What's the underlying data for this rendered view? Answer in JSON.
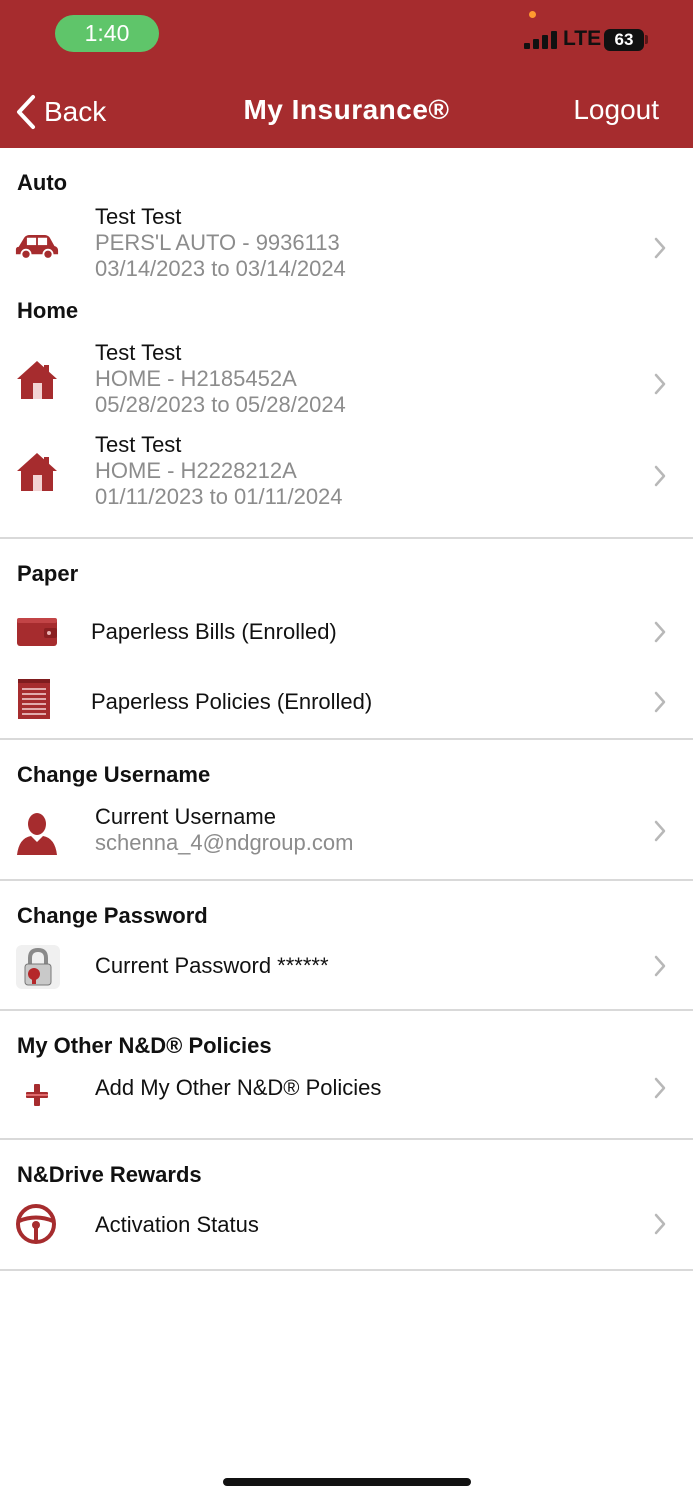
{
  "status_bar": {
    "time": "1:40",
    "network": "LTE",
    "battery": "63"
  },
  "nav": {
    "back_label": "Back",
    "title": "My Insurance®",
    "logout_label": "Logout"
  },
  "sections": {
    "auto": {
      "title": "Auto",
      "items": [
        {
          "name": "Test Test",
          "policy": "PERS'L AUTO - 9936113",
          "dates": "03/14/2023 to 03/14/2024"
        }
      ]
    },
    "home": {
      "title": "Home",
      "items": [
        {
          "name": "Test Test",
          "policy": "HOME - H2185452A",
          "dates": "05/28/2023 to 05/28/2024"
        },
        {
          "name": "Test Test",
          "policy": "HOME - H2228212A",
          "dates": "01/11/2023 to 01/11/2024"
        }
      ]
    },
    "paper": {
      "title": "Paper",
      "bills_label": "Paperless Bills (Enrolled)",
      "policies_label": "Paperless Policies (Enrolled)"
    },
    "username": {
      "title": "Change Username",
      "label": "Current Username",
      "value": "schenna_4@ndgroup.com"
    },
    "password": {
      "title": "Change Password",
      "label": "Current Password ******"
    },
    "other_policies": {
      "title": "My Other N&D® Policies",
      "label": "Add My Other N&D® Policies"
    },
    "rewards": {
      "title": "N&Drive Rewards",
      "label": "Activation Status"
    }
  },
  "colors": {
    "brand": "#a62c2e",
    "status_green": "#5fc56a",
    "secondary_text": "#8c8c8c",
    "chevron": "#b8b8b8"
  }
}
